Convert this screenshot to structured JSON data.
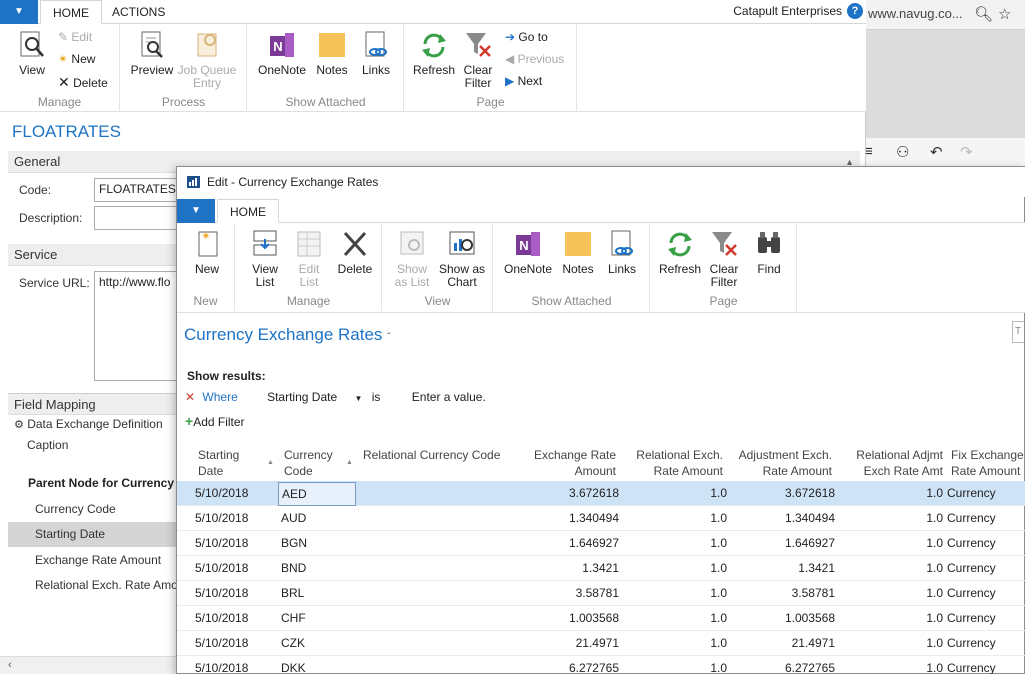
{
  "browser": {
    "url_fragment": "www.navug.co...",
    "search_icon": "search-icon",
    "star_icon": "star-icon"
  },
  "back_window": {
    "tabs": [
      "HOME",
      "ACTIONS"
    ],
    "company": "Catapult Enterprises",
    "ribbon": {
      "manage": {
        "label": "Manage",
        "view": "View",
        "edit": "Edit",
        "new": "New",
        "delete": "Delete"
      },
      "process": {
        "label": "Process",
        "preview": "Preview",
        "job_queue_entry_1": "Job Queue",
        "job_queue_entry_2": "Entry"
      },
      "show_attached": {
        "label": "Show Attached",
        "onenote": "OneNote",
        "notes": "Notes",
        "links": "Links"
      },
      "page": {
        "label": "Page",
        "refresh": "Refresh",
        "clear_filter_1": "Clear",
        "clear_filter_2": "Filter",
        "go_to": "Go to",
        "previous": "Previous",
        "next": "Next"
      }
    },
    "title": "FLOATRATES",
    "general": {
      "header": "General",
      "code_label": "Code:",
      "code_value": "FLOATRATES",
      "description_label": "Description:",
      "description_value": ""
    },
    "service": {
      "header": "Service",
      "url_label": "Service URL:",
      "url_value": "http://www.flo"
    },
    "field_mapping": {
      "header": "Field Mapping",
      "data_exchange_def": "Data Exchange Definition",
      "caption": "Caption",
      "rows": [
        {
          "label": "Parent Node for Currency",
          "bold": true
        },
        {
          "label": "Currency Code",
          "bold": false
        },
        {
          "label": "Starting Date",
          "bold": false
        },
        {
          "label": "Exchange Rate Amount",
          "bold": false
        },
        {
          "label": "Relational Exch. Rate Amount",
          "bold": false
        }
      ]
    }
  },
  "front_window": {
    "title": "Edit - Currency Exchange Rates",
    "tab": "HOME",
    "ribbon": {
      "new_group": {
        "label": "New",
        "new": "New"
      },
      "manage": {
        "label": "Manage",
        "view_list_1": "View",
        "view_list_2": "List",
        "edit_list_1": "Edit",
        "edit_list_2": "List",
        "delete": "Delete"
      },
      "view": {
        "label": "View",
        "show_as_list_1": "Show",
        "show_as_list_2": "as List",
        "show_as_chart_1": "Show as",
        "show_as_chart_2": "Chart"
      },
      "show_attached": {
        "label": "Show Attached",
        "onenote": "OneNote",
        "notes": "Notes",
        "links": "Links"
      },
      "page": {
        "label": "Page",
        "refresh": "Refresh",
        "clear_filter_1": "Clear",
        "clear_filter_2": "Filter",
        "find": "Find"
      }
    },
    "list_title": "Currency Exchange Rates",
    "show_results": "Show results:",
    "filter": {
      "where": "Where",
      "field": "Starting Date",
      "operator": "is",
      "value": "Enter a value."
    },
    "add_filter": "Add Filter",
    "columns": [
      [
        "Starting",
        "Date"
      ],
      [
        "Currency",
        "Code"
      ],
      [
        "Relational Currency Code",
        ""
      ],
      [
        "Exchange Rate",
        "Amount"
      ],
      [
        "Relational Exch.",
        "Rate Amount"
      ],
      [
        "Adjustment Exch.",
        "Rate Amount"
      ],
      [
        "Relational Adjmt",
        "Exch Rate Amt"
      ],
      [
        "Fix Exchange",
        "Rate Amount"
      ]
    ],
    "rows": [
      {
        "date": "5/10/2018",
        "code": "AED",
        "rel_code": "",
        "rate": "3.672618",
        "rel_rate": "1.0",
        "adj": "3.672618",
        "rel_adj": "1.0",
        "fix": "Currency"
      },
      {
        "date": "5/10/2018",
        "code": "AUD",
        "rel_code": "",
        "rate": "1.340494",
        "rel_rate": "1.0",
        "adj": "1.340494",
        "rel_adj": "1.0",
        "fix": "Currency"
      },
      {
        "date": "5/10/2018",
        "code": "BGN",
        "rel_code": "",
        "rate": "1.646927",
        "rel_rate": "1.0",
        "adj": "1.646927",
        "rel_adj": "1.0",
        "fix": "Currency"
      },
      {
        "date": "5/10/2018",
        "code": "BND",
        "rel_code": "",
        "rate": "1.3421",
        "rel_rate": "1.0",
        "adj": "1.3421",
        "rel_adj": "1.0",
        "fix": "Currency"
      },
      {
        "date": "5/10/2018",
        "code": "BRL",
        "rel_code": "",
        "rate": "3.58781",
        "rel_rate": "1.0",
        "adj": "3.58781",
        "rel_adj": "1.0",
        "fix": "Currency"
      },
      {
        "date": "5/10/2018",
        "code": "CHF",
        "rel_code": "",
        "rate": "1.003568",
        "rel_rate": "1.0",
        "adj": "1.003568",
        "rel_adj": "1.0",
        "fix": "Currency"
      },
      {
        "date": "5/10/2018",
        "code": "CZK",
        "rel_code": "",
        "rate": "21.4971",
        "rel_rate": "1.0",
        "adj": "21.4971",
        "rel_adj": "1.0",
        "fix": "Currency"
      },
      {
        "date": "5/10/2018",
        "code": "DKK",
        "rel_code": "",
        "rate": "6.272765",
        "rel_rate": "1.0",
        "adj": "6.272765",
        "rel_adj": "1.0",
        "fix": "Currency"
      }
    ]
  },
  "colors": {
    "accent": "#1e73c4",
    "selected_row": "#cfe3f6",
    "filter_x": "#d03a2b"
  }
}
